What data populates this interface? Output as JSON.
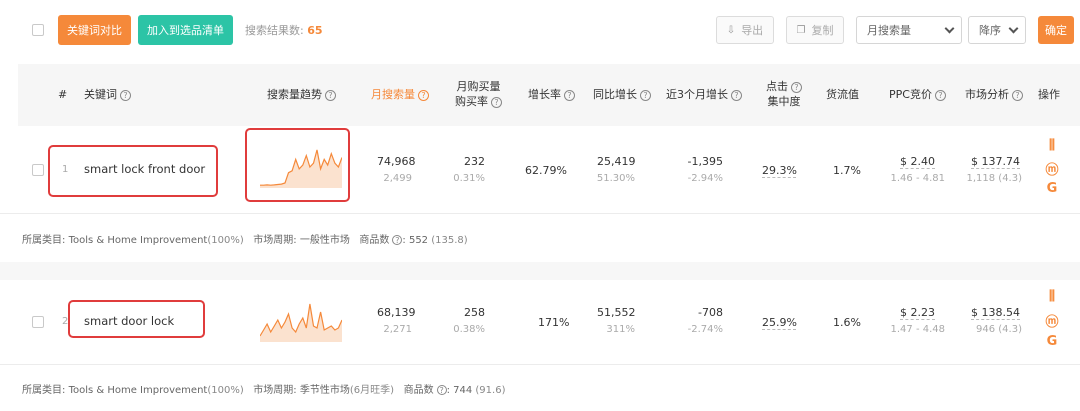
{
  "toolbar": {
    "compare_label": "关键词对比",
    "add_list_label": "加入到选品清单",
    "result_label": "搜索结果数:",
    "result_count": "65",
    "export_label": "导出",
    "copy_label": "复制",
    "sort_field": "月搜索量",
    "sort_order": "降序",
    "confirm_label": "确定"
  },
  "columns": {
    "index": "#",
    "keyword": "关键词",
    "trend": "搜索量趋势",
    "monthly": "月搜索量",
    "buy_rate_1": "月购买量",
    "buy_rate_2": "购买率",
    "growth": "增长率",
    "yoy": "同比增长",
    "recent3": "近3个月增长",
    "click_1": "点击",
    "click_2": "集中度",
    "supply": "货流值",
    "ppc": "PPC竞价",
    "market": "市场分析",
    "ops": "操作"
  },
  "rows": [
    {
      "index": "1",
      "keyword": "smart lock front door",
      "monthly": "74,968",
      "monthly_sub": "2,499",
      "buy": "232",
      "buy_rate": "0.31%",
      "growth": "62.79%",
      "yoy": "25,419",
      "yoy_pct": "51.30%",
      "recent3": "-1,395",
      "recent3_pct": "-2.94%",
      "click": "29.3%",
      "supply": "1.7%",
      "ppc": "$ 2.40",
      "ppc_range": "1.46 - 4.81",
      "market": "$ 137.74",
      "market_sub": "1,118 (4.3)",
      "meta_cat_label": "所属类目:",
      "meta_cat": "Tools & Home Improvement",
      "meta_cat_pct": "(100%)",
      "meta_cycle_label": "市场周期:",
      "meta_cycle": "一般性市场",
      "meta_cycle_extra": "",
      "meta_goods_label": "商品数",
      "meta_goods": ": 552",
      "meta_goods_sub": "(135.8)",
      "spark": [
        0.02,
        0.02,
        0.03,
        0.02,
        0.03,
        0.04,
        0.05,
        0.08,
        0.35,
        0.4,
        0.7,
        0.45,
        0.55,
        0.8,
        0.5,
        0.6,
        0.95,
        0.45,
        0.7,
        0.55,
        0.85,
        0.6,
        0.5,
        0.75
      ]
    },
    {
      "index": "2",
      "keyword": "smart door lock",
      "monthly": "68,139",
      "monthly_sub": "2,271",
      "buy": "258",
      "buy_rate": "0.38%",
      "growth": "171%",
      "yoy": "51,552",
      "yoy_pct": "311%",
      "recent3": "-708",
      "recent3_pct": "-2.74%",
      "click": "25.9%",
      "supply": "1.6%",
      "ppc": "$ 2.23",
      "ppc_range": "1.47 - 4.48",
      "market": "$ 138.54",
      "market_sub": "946 (4.3)",
      "meta_cat_label": "所属类目:",
      "meta_cat": "Tools & Home Improvement",
      "meta_cat_pct": "(100%)",
      "meta_cycle_label": "市场周期:",
      "meta_cycle": "季节性市场",
      "meta_cycle_extra": "(6月旺季)",
      "meta_goods_label": "商品数",
      "meta_goods": ": 744",
      "meta_goods_sub": "(91.6)",
      "spark": [
        0.1,
        0.25,
        0.4,
        0.2,
        0.35,
        0.5,
        0.3,
        0.45,
        0.65,
        0.3,
        0.2,
        0.4,
        0.55,
        0.3,
        0.9,
        0.35,
        0.3,
        0.7,
        0.25,
        0.3,
        0.35,
        0.25,
        0.3,
        0.5
      ]
    }
  ],
  "colors": {
    "accent": "#f5893a",
    "teal": "#2cc4a6",
    "highlight": "#e03c3c"
  }
}
